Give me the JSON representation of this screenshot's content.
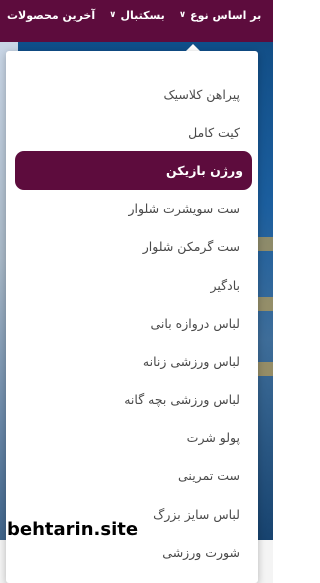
{
  "navbar": {
    "items": [
      {
        "label": "بر اساس نوع",
        "has_chevron": true
      },
      {
        "label": "بسکتبال",
        "has_chevron": true
      },
      {
        "label": "آخرین محصولات",
        "has_chevron": false
      }
    ]
  },
  "dropdown": {
    "items": [
      {
        "label": "پیراهن کلاسیک"
      },
      {
        "label": "کیت کامل"
      },
      {
        "label": "ورژن بازیکن",
        "active": true
      },
      {
        "label": "ست سویشرت شلوار"
      },
      {
        "label": "ست گرمکن شلوار"
      },
      {
        "label": "بادگیر"
      },
      {
        "label": "لباس دروازه بانی"
      },
      {
        "label": "لباس ورزشی زنانه"
      },
      {
        "label": "لباس ورزشی بچه گانه"
      },
      {
        "label": "پولو شرت"
      },
      {
        "label": "ست تمرینی"
      },
      {
        "label": "لباس سایز بزرگ"
      },
      {
        "label": "شورت ورزشی"
      }
    ]
  },
  "watermark": "behtarin.site",
  "colors": {
    "brand": "#5d0c3d",
    "menu_text": "#4a4a4a"
  }
}
